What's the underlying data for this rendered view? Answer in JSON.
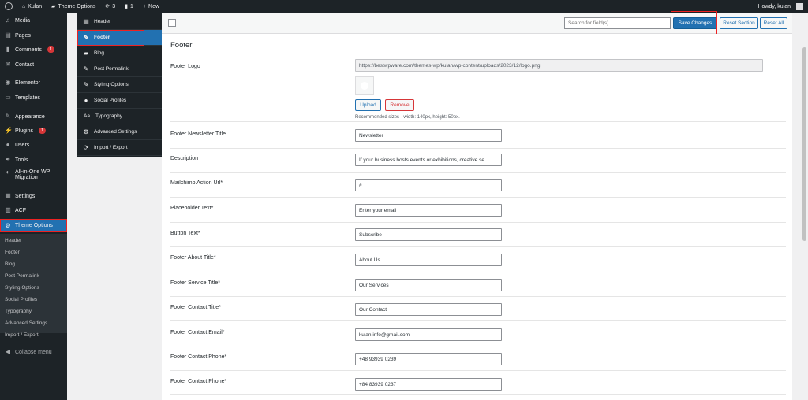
{
  "adminbar": {
    "site": "Kulan",
    "theme_options": "Theme Options",
    "updates_count": "3",
    "comments_count": "1",
    "new": "New",
    "howdy": "Howdy, kulan"
  },
  "menu": {
    "items": [
      {
        "label": "Media",
        "icon": "media-icon"
      },
      {
        "label": "Pages",
        "icon": "pages-icon"
      },
      {
        "label": "Comments",
        "icon": "comments-icon",
        "badge": "1"
      },
      {
        "label": "Contact",
        "icon": "contact-icon"
      },
      {
        "label": "Elementor",
        "icon": "elementor-icon"
      },
      {
        "label": "Templates",
        "icon": "templates-icon"
      },
      {
        "label": "Appearance",
        "icon": "appearance-icon"
      },
      {
        "label": "Plugins",
        "icon": "plugins-icon",
        "badge": "1"
      },
      {
        "label": "Users",
        "icon": "users-icon"
      },
      {
        "label": "Tools",
        "icon": "tools-icon"
      },
      {
        "label": "All-in-One WP",
        "label2": "Migration",
        "icon": "migration-icon"
      },
      {
        "label": "Settings",
        "icon": "settings-icon"
      },
      {
        "label": "ACF",
        "icon": "acf-icon"
      },
      {
        "label": "Theme Options",
        "icon": "gear-icon"
      }
    ],
    "submenu": [
      "Header",
      "Footer",
      "Blog",
      "Post Permalink",
      "Styling Options",
      "Social Profiles",
      "Typography",
      "Advanced Settings",
      "Import / Export"
    ],
    "collapse": "Collapse menu"
  },
  "options_sidebar": {
    "items": [
      "Header",
      "Footer",
      "Blog",
      "Post Permalink",
      "Styling Options",
      "Social Profiles",
      "Typography",
      "Advanced Settings",
      "Import / Export"
    ],
    "active": "Footer",
    "icon_aa": "Aa"
  },
  "toolbar": {
    "search_placeholder": "Search for field(s)",
    "save": "Save Changes",
    "reset_section": "Reset Section",
    "reset_all": "Reset All"
  },
  "panel": {
    "title": "Footer",
    "logo_label": "Footer Logo",
    "logo_url": "https://bestwpware.com/themes-wp/kulan/wp-content/uploads/2023/12/logo.png",
    "upload": "Upload",
    "remove": "Remove",
    "hint": "Recommended sizes - width: 140px, height: 50px.",
    "fields": [
      {
        "label": "Footer Newsletter Title",
        "value": "Newsletter"
      },
      {
        "label": "Description",
        "value": "If your business hosts events or exhibitions, creative se"
      },
      {
        "label": "Mailchimp Action Url*",
        "value": "#"
      },
      {
        "label": "Placeholder Text*",
        "value": "Enter your email"
      },
      {
        "label": "Button Text*",
        "value": "Subscribe"
      },
      {
        "label": "Footer About Title*",
        "value": "About Us"
      },
      {
        "label": "Footer Service Title*",
        "value": "Our Services"
      },
      {
        "label": "Footer Contact Title*",
        "value": "Our Contact"
      },
      {
        "label": "Footer Contact Email*",
        "value": "kulan.info@gmail.com"
      },
      {
        "label": "Footer Contact Phone*",
        "value": "+48 93939 0239"
      },
      {
        "label": "Footer Contact Phone*",
        "value": "+84 83939 0237"
      }
    ]
  },
  "colors": {
    "wp_dark": "#1d2327",
    "wp_blue": "#2271b1",
    "highlight_red": "#ee2222"
  }
}
